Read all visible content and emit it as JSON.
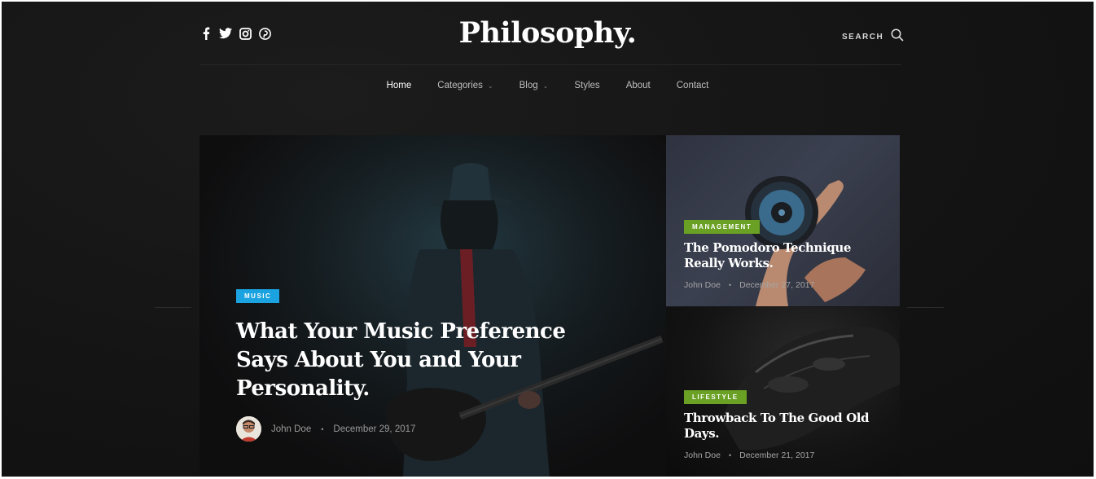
{
  "header": {
    "logo": "Philosophy.",
    "search_label": "SEARCH",
    "social": [
      "facebook-icon",
      "twitter-icon",
      "instagram-icon",
      "pinterest-icon"
    ]
  },
  "nav": {
    "items": [
      {
        "label": "Home",
        "active": true,
        "dropdown": false
      },
      {
        "label": "Categories",
        "active": false,
        "dropdown": true
      },
      {
        "label": "Blog",
        "active": false,
        "dropdown": true
      },
      {
        "label": "Styles",
        "active": false,
        "dropdown": false
      },
      {
        "label": "About",
        "active": false,
        "dropdown": false
      },
      {
        "label": "Contact",
        "active": false,
        "dropdown": false
      }
    ]
  },
  "featured": {
    "tag": "MUSIC",
    "tag_color": "#1aa3e0",
    "title": "What Your Music Preference Says About You and Your Personality.",
    "author": "John Doe",
    "date": "December 29, 2017"
  },
  "side_posts": [
    {
      "tag": "MANAGEMENT",
      "tag_color": "#6aa024",
      "title": "The Pomodoro Technique Really Works.",
      "author": "John Doe",
      "date": "December 27, 2017"
    },
    {
      "tag": "LIFESTYLE",
      "tag_color": "#6aa024",
      "title": "Throwback To The Good Old Days.",
      "author": "John Doe",
      "date": "December 21, 2017"
    }
  ],
  "colors": {
    "background": "#141414",
    "text": "#ffffff",
    "muted": "#9a9a9a"
  }
}
